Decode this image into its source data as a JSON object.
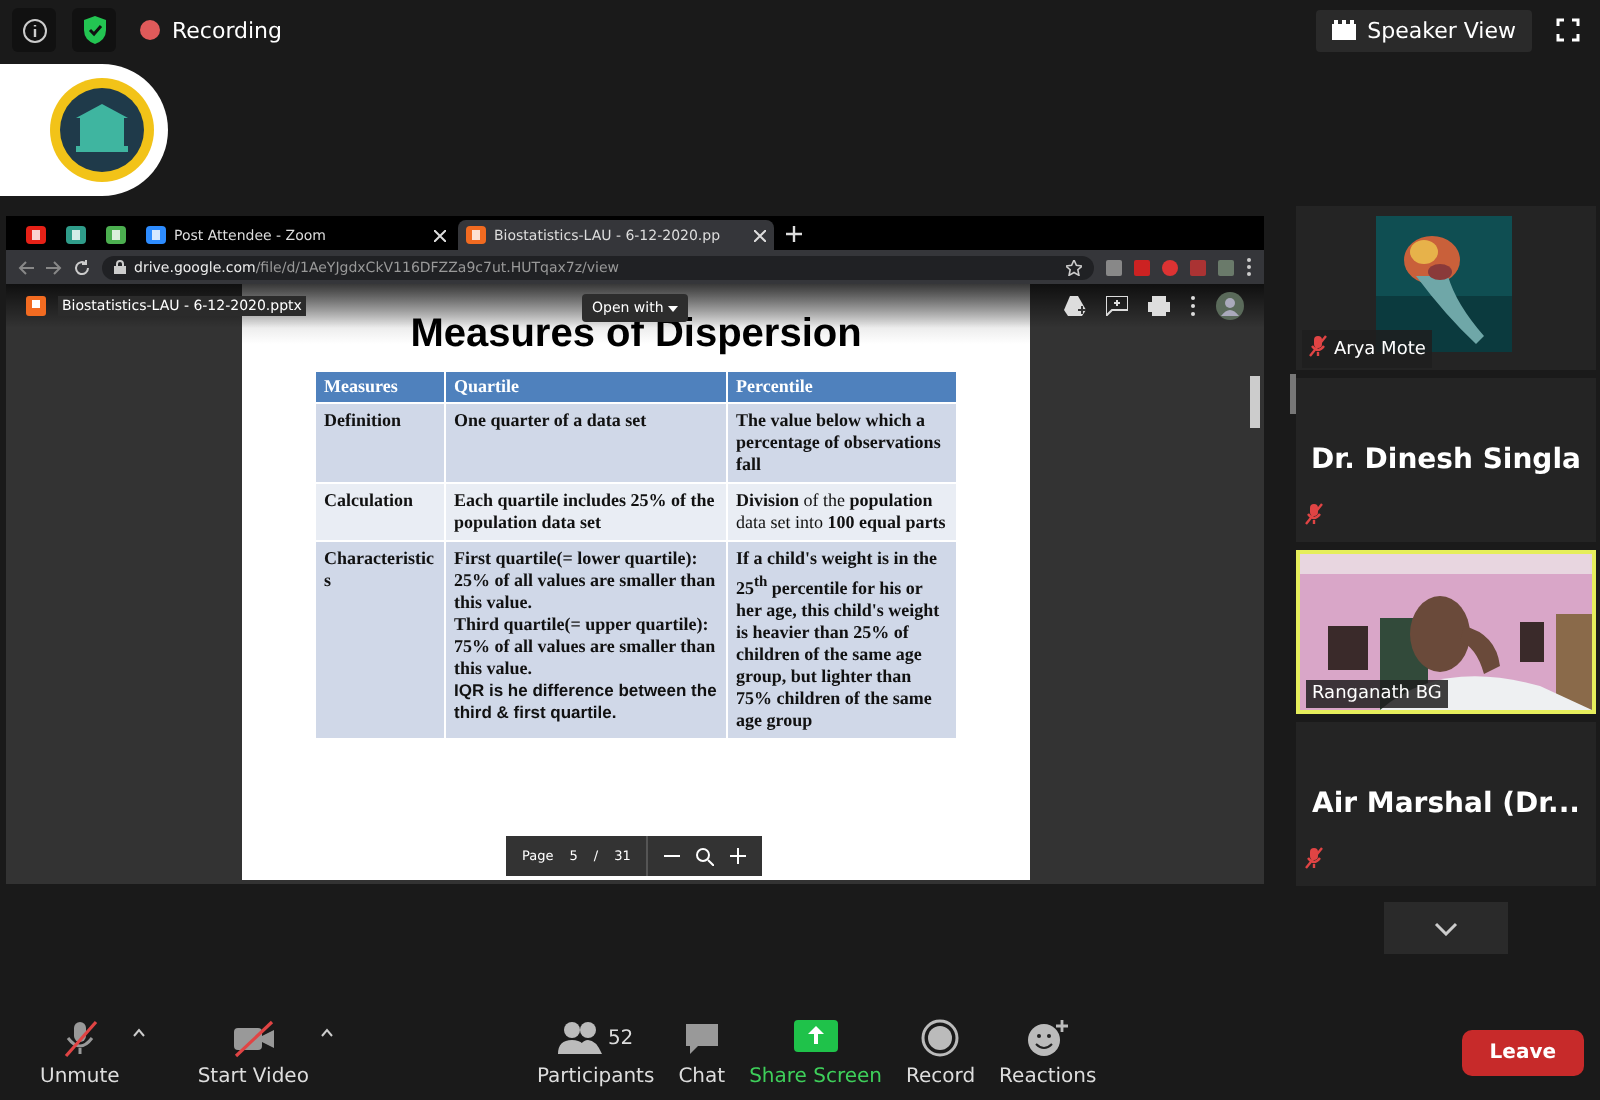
{
  "top_bar": {
    "recording": "Recording",
    "view_button": "Speaker View"
  },
  "browser": {
    "tabs": [
      {
        "kind": "icon",
        "color": "#e62117",
        "selected": false
      },
      {
        "kind": "icon",
        "color": "#2f9c8a",
        "selected": false
      },
      {
        "kind": "icon",
        "color": "#4caf50",
        "selected": false
      },
      {
        "kind": "titled",
        "title": "Post Attendee - Zoom",
        "color": "#2d8cff",
        "selected": false
      },
      {
        "kind": "titled",
        "title": "Biostatistics-LAU - 6-12-2020.pp",
        "color": "#f26b21",
        "selected": true
      }
    ],
    "url_host": "drive.google.com",
    "url_path": "/file/d/1AeYJgdxCkV116DFZZa9c7ut.HUTqax7z/view"
  },
  "viewer": {
    "file_name": "Biostatistics-LAU - 6-12-2020.pptx",
    "open_with": "Open with",
    "slide": {
      "title": "Measures of Dispersion",
      "table": {
        "columns": [
          "Measures",
          "Quartile",
          "Percentile"
        ],
        "rows": [
          {
            "cells": [
              [
                {
                  "kind": "serif",
                  "text": "Definition"
                }
              ],
              [
                {
                  "kind": "serif",
                  "text": "One quarter of a data set"
                }
              ],
              [
                {
                  "kind": "serif",
                  "text": "The value below which a percentage of observations fall"
                }
              ]
            ]
          },
          {
            "cells": [
              [
                {
                  "kind": "serif",
                  "text": "Calculation"
                }
              ],
              [
                {
                  "kind": "serif",
                  "text": "Each quartile includes 25% of the population data set"
                }
              ],
              [
                {
                  "kind": "plain",
                  "text": "**Division** of the **population** data set into **100 equal parts**"
                }
              ]
            ]
          },
          {
            "cells": [
              [
                {
                  "kind": "serif",
                  "text": "Characteristics"
                }
              ],
              [
                {
                  "kind": "serif",
                  "text": "First quartile(= lower quartile): 25% of all values are smaller than this value."
                },
                {
                  "kind": "serif",
                  "text": "Third quartile(= upper quartile): 75% of all values are smaller than this value."
                },
                {
                  "kind": "sans",
                  "text": "IQR is he difference between the third & first quartile."
                }
              ],
              [
                {
                  "kind": "serif",
                  "text": "If a child's weight is in the 25$^{th}$ percentile for his or her age, this child's weight is heavier than 25% of children of the same age group, but lighter than 75% children of the same age group"
                }
              ]
            ]
          }
        ]
      }
    },
    "pager": {
      "label": "Page",
      "page": "5",
      "separator": "/",
      "total": "31"
    }
  },
  "participants": [
    {
      "kind": "picture",
      "name": "Arya Mote",
      "muted": true,
      "speaking": false
    },
    {
      "kind": "name",
      "name": "Dr. Dinesh Singla",
      "muted": true,
      "speaking": false
    },
    {
      "kind": "video",
      "name": "Ranganath BG",
      "muted": false,
      "speaking": true
    },
    {
      "kind": "name",
      "name": "Air Marshal  (Dr...",
      "muted": true,
      "speaking": false
    }
  ],
  "toolbar": [
    {
      "kind": "mic",
      "label": "Unmute",
      "caret": true
    },
    {
      "kind": "camera",
      "label": "Start Video",
      "caret": true
    },
    {
      "kind": "participants",
      "label": "Participants",
      "count": "52"
    },
    {
      "kind": "chat",
      "label": "Chat"
    },
    {
      "kind": "share",
      "label": "Share Screen"
    },
    {
      "kind": "record",
      "label": "Record"
    },
    {
      "kind": "reactions",
      "label": "Reactions"
    }
  ],
  "leave": "Leave"
}
